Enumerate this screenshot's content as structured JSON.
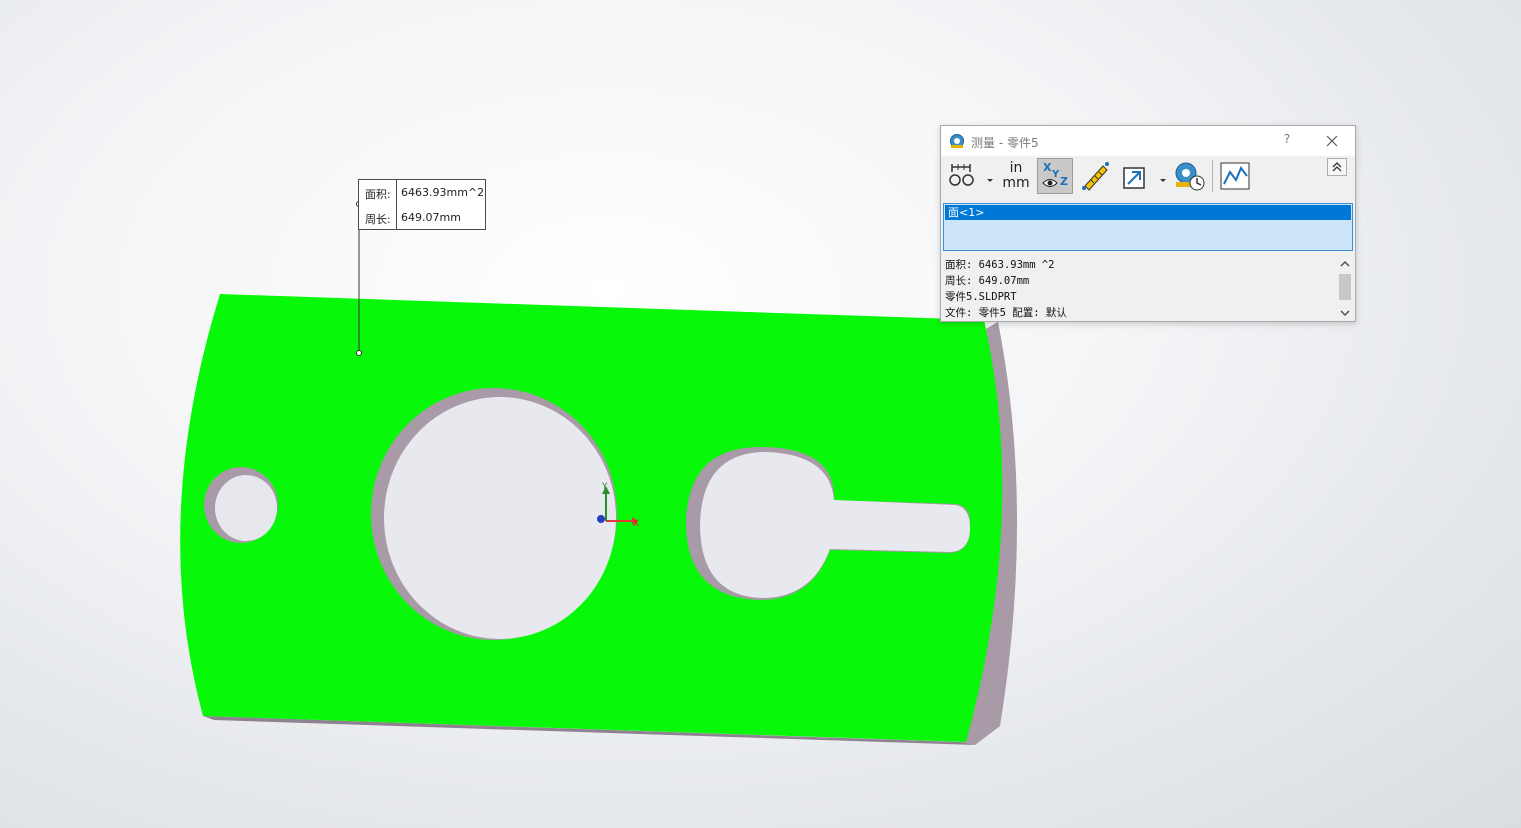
{
  "viewport": {
    "part_color": "#08f80a",
    "edge_color": "#a89aa6",
    "axis": {
      "x_label": "X",
      "y_label": "Y"
    }
  },
  "callout": {
    "area_label": "面积:",
    "area_value": "6463.93mm^2",
    "perimeter_label": "周长:",
    "perimeter_value": "649.07mm"
  },
  "dialog": {
    "title": "测量 - 零件5",
    "help_label": "?",
    "toolbar": [
      {
        "icon": "arc-circle-measure-icon"
      },
      {
        "icon": "units-precision-icon",
        "label_top": "in",
        "label_bottom": "mm"
      },
      {
        "icon": "show-xyz-measurements-icon",
        "active": true
      },
      {
        "icon": "point-to-point-icon"
      },
      {
        "icon": "projection-select-icon"
      },
      {
        "icon": "measurement-history-icon"
      },
      {
        "icon": "create-sensor-icon"
      }
    ],
    "selection": [
      "面<1>"
    ],
    "results": [
      "面积: 6463.93mm ^2",
      "周长: 649.07mm",
      "零件5.SLDPRT",
      "文件: 零件5 配置: 默认"
    ],
    "selection_color": "#0078d7"
  }
}
